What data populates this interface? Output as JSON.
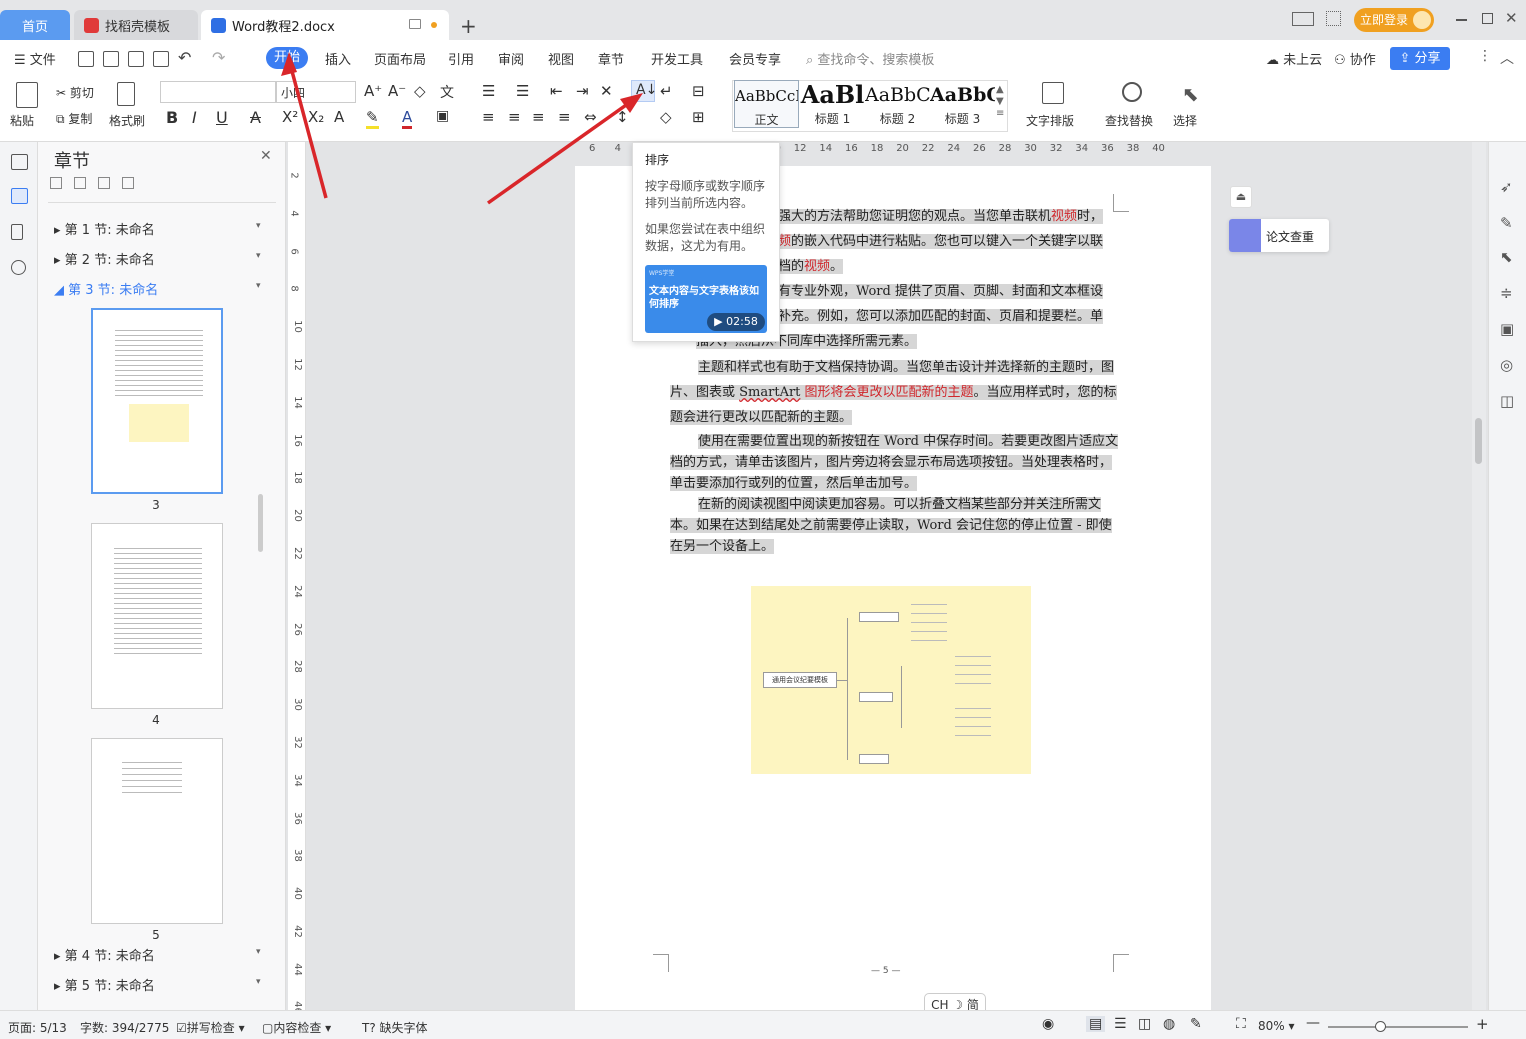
{
  "tabs": {
    "home": "首页",
    "template": "找稻壳模板",
    "doc": "Word教程2.docx"
  },
  "window": {
    "login": "立即登录"
  },
  "menu": {
    "file": "文件",
    "start": "开始",
    "insert": "插入",
    "layout": "页面布局",
    "reference": "引用",
    "review": "审阅",
    "view": "视图",
    "chapter": "章节",
    "developer": "开发工具",
    "member": "会员专享",
    "search_placeholder": "查找命令、搜索模板",
    "cloud": "未上云",
    "collab": "协作",
    "share": "分享"
  },
  "toolbar": {
    "paste": "粘贴",
    "cut": "剪切",
    "copy": "复制",
    "format_painter": "格式刷",
    "font_name": "",
    "font_size": "小四",
    "styles": [
      {
        "preview": "AaBbCcDd",
        "label": "正文"
      },
      {
        "preview": "AaBl",
        "label": "标题 1"
      },
      {
        "preview": "AaBbC",
        "label": "标题 2"
      },
      {
        "preview": "AaBbC",
        "label": "标题 3"
      }
    ],
    "text_layout": "文字排版",
    "find_replace": "查找替换",
    "select": "选择"
  },
  "chapter_panel": {
    "title": "章节",
    "sections": [
      "第 1 节: 未命名",
      "第 2 节: 未命名",
      "第 3 节: 未命名",
      "第 4 节: 未命名",
      "第 5 节: 未命名"
    ],
    "thumbs": [
      "3",
      "4",
      "5"
    ]
  },
  "tooltip": {
    "title": "排序",
    "desc1": "按字母顺序或数字顺序排列当前所选内容。",
    "desc2": "如果您尝试在表中组织数据，这尤为有用。",
    "video_brand": "WPS学堂",
    "video_title": "文本内容与文字表格该如何排序",
    "video_time": "02:58"
  },
  "document": {
    "p1a": "能强大的方法帮助您证明您的观点。当您单击联机",
    "p1b": "视频",
    "p1c": "时，",
    "p1d": "视频",
    "p1e": "的嵌入代码中进行粘贴。您也可以键入一个关键字以联",
    "p1f": "文档的",
    "p1g": "视频",
    "p1h": "。",
    "p2a": "具有专业外观，Word 提供了页眉、页脚、封面和文本框设",
    "p2b": "的补充。例如，您可以添加匹配的封面、页眉和提要栏。单",
    "p2c": "插入，然后从不同库中选择所需元素。",
    "p3a": "主题和样式也有助于文档保持协调。当您单击设计并选择新的主题时，图片、图表或 ",
    "p3b": "SmartArt",
    "p3c": " 图形将会更改以匹配新的主题",
    "p3d": "。当应用样式时，您的标题会进行更改以匹配新的主题。",
    "p4": "使用在需要位置出现的新按钮在 Word 中保存时间。若要更改图片适应文档的方式，请单击该图片，图片旁边将会显示布局选项按钮。当处理表格时，单击要添加行或列的位置，然后单击加号。",
    "p5": "在新的阅读视图中阅读更加容易。可以折叠文档某些部分并关注所需文本。如果在达到结尾处之前需要停止读取，Word 会记住您的停止位置 - 即使在另一个设备上。",
    "page_footer": "— 5 —",
    "mindmap_root": "通用会议纪要模板"
  },
  "side": {
    "paper_check": "论文查重"
  },
  "ime": "CH ☽ 简",
  "status": {
    "page": "页面: 5/13",
    "words": "字数: 394/2775",
    "spell": "拼写检查",
    "content_check": "内容检查",
    "missing_font": "缺失字体",
    "zoom": "80%"
  },
  "colors": {
    "accent": "#3b7df2",
    "home_tab": "#5b9bf0",
    "login": "#f0a020",
    "red_text": "#d0262b",
    "annotation_arrow": "#d9262a"
  }
}
